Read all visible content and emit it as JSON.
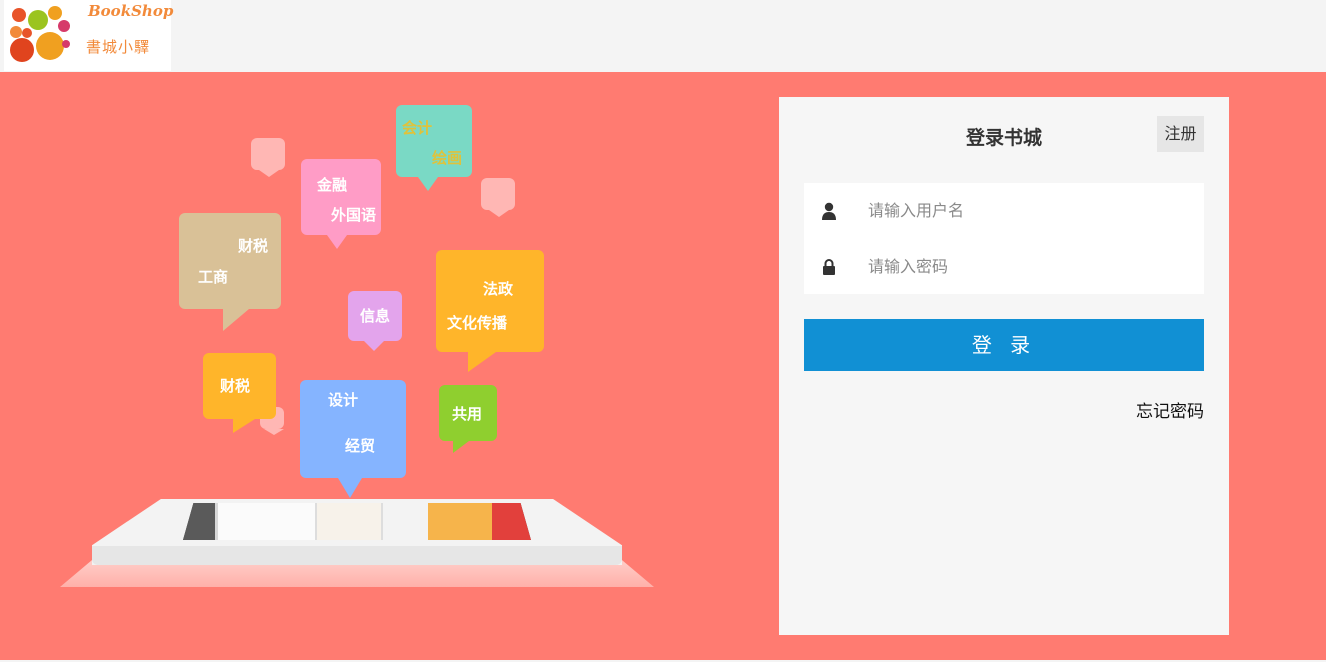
{
  "header": {
    "logo_text_en": "BookShop",
    "logo_text_cn": "書城小驛"
  },
  "illustration": {
    "bubbles": [
      {
        "id": "accounting",
        "lines": [
          "会计",
          "绘画"
        ],
        "color": "#7ad9c5",
        "text_color": "#e0c23a"
      },
      {
        "id": "finance",
        "lines": [
          "金融",
          "外国语"
        ],
        "color": "#ff9cc6"
      },
      {
        "id": "tax-business",
        "lines": [
          "财税",
          "工商"
        ],
        "color": "#d9c197"
      },
      {
        "id": "info",
        "lines": [
          "信息"
        ],
        "color": "#e3a4ec"
      },
      {
        "id": "law",
        "lines": [
          "法政",
          "文化传播"
        ],
        "color": "#ffb52a"
      },
      {
        "id": "tax",
        "lines": [
          "财税"
        ],
        "color": "#ffb52a"
      },
      {
        "id": "design",
        "lines": [
          "设计",
          "经贸"
        ],
        "color": "#85b4ff"
      },
      {
        "id": "shared",
        "lines": [
          "共用"
        ],
        "color": "#8fcf2f"
      }
    ]
  },
  "login": {
    "title": "登录书城",
    "register_label": "注册",
    "username_placeholder": "请输入用户名",
    "password_placeholder": "请输入密码",
    "submit_label": "登 录",
    "forgot_label": "忘记密码",
    "user_icon": "user-icon",
    "lock_icon": "lock-icon"
  },
  "colors": {
    "hero_background": "#ff7b71",
    "login_button": "#1190d4",
    "panel_background": "#f6f6f6"
  }
}
